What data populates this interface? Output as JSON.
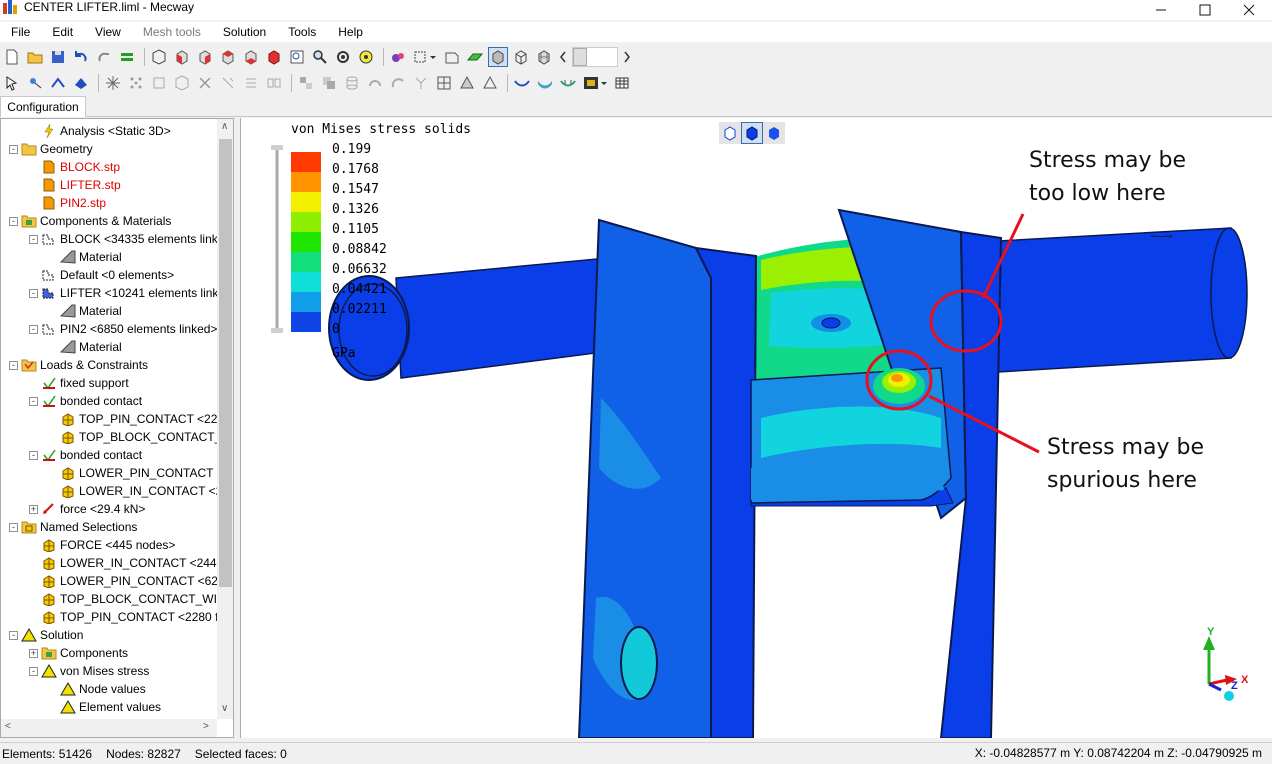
{
  "window": {
    "title": "CENTER LIFTER.liml - Mecway"
  },
  "menu": [
    {
      "label": "File",
      "enabled": true
    },
    {
      "label": "Edit",
      "enabled": true
    },
    {
      "label": "View",
      "enabled": true
    },
    {
      "label": "Mesh tools",
      "enabled": false
    },
    {
      "label": "Solution",
      "enabled": true
    },
    {
      "label": "Tools",
      "enabled": true
    },
    {
      "label": "Help",
      "enabled": true
    }
  ],
  "config_tab": {
    "label": "Configuration"
  },
  "tree": [
    {
      "label": "Analysis <Static 3D>",
      "level": 1,
      "icon": "analysis-icon",
      "color": "black",
      "expander": ""
    },
    {
      "label": "Geometry",
      "level": 0,
      "icon": "folder-icon",
      "color": "black",
      "expander": "-"
    },
    {
      "label": "BLOCK.stp",
      "level": 1,
      "icon": "geometry-file-icon",
      "color": "red",
      "expander": ""
    },
    {
      "label": "LIFTER.stp",
      "level": 1,
      "icon": "geometry-file-icon",
      "color": "red",
      "expander": ""
    },
    {
      "label": "PIN2.stp",
      "level": 1,
      "icon": "geometry-file-icon",
      "color": "red",
      "expander": ""
    },
    {
      "label": "Components & Materials",
      "level": 0,
      "icon": "components-icon",
      "color": "black",
      "expander": "-"
    },
    {
      "label": "BLOCK <34335 elements link",
      "level": 1,
      "icon": "component-icon",
      "color": "black",
      "expander": "-"
    },
    {
      "label": "Material",
      "level": 2,
      "icon": "material-icon",
      "color": "black",
      "expander": ""
    },
    {
      "label": "Default <0 elements>",
      "level": 1,
      "icon": "component-icon",
      "color": "black",
      "expander": ""
    },
    {
      "label": "LIFTER <10241 elements linke",
      "level": 1,
      "icon": "component-blue-icon",
      "color": "black",
      "expander": "-"
    },
    {
      "label": "Material",
      "level": 2,
      "icon": "material-icon",
      "color": "black",
      "expander": ""
    },
    {
      "label": "PIN2 <6850 elements linked>",
      "level": 1,
      "icon": "component-icon",
      "color": "black",
      "expander": "-"
    },
    {
      "label": "Material",
      "level": 2,
      "icon": "material-icon",
      "color": "black",
      "expander": ""
    },
    {
      "label": "Loads & Constraints",
      "level": 0,
      "icon": "loads-folder-icon",
      "color": "black",
      "expander": "-"
    },
    {
      "label": "fixed support",
      "level": 1,
      "icon": "constraint-icon",
      "color": "black",
      "expander": ""
    },
    {
      "label": "bonded contact",
      "level": 1,
      "icon": "constraint-icon",
      "color": "black",
      "expander": "-"
    },
    {
      "label": "TOP_PIN_CONTACT <228",
      "level": 2,
      "icon": "selection-icon",
      "color": "black",
      "expander": ""
    },
    {
      "label": "TOP_BLOCK_CONTACT_W",
      "level": 2,
      "icon": "selection-icon",
      "color": "black",
      "expander": ""
    },
    {
      "label": "bonded contact",
      "level": 1,
      "icon": "constraint-icon",
      "color": "black",
      "expander": "-"
    },
    {
      "label": "LOWER_PIN_CONTACT <",
      "level": 2,
      "icon": "selection-icon",
      "color": "black",
      "expander": ""
    },
    {
      "label": "LOWER_IN_CONTACT <2",
      "level": 2,
      "icon": "selection-icon",
      "color": "black",
      "expander": ""
    },
    {
      "label": "force <29.4 kN>",
      "level": 1,
      "icon": "force-icon",
      "color": "black",
      "expander": "+"
    },
    {
      "label": "Named Selections",
      "level": 0,
      "icon": "named-selections-icon",
      "color": "black",
      "expander": "-"
    },
    {
      "label": "FORCE <445 nodes>",
      "level": 1,
      "icon": "selection-icon",
      "color": "black",
      "expander": ""
    },
    {
      "label": "LOWER_IN_CONTACT <244 f",
      "level": 1,
      "icon": "selection-icon",
      "color": "black",
      "expander": ""
    },
    {
      "label": "LOWER_PIN_CONTACT <623",
      "level": 1,
      "icon": "selection-icon",
      "color": "black",
      "expander": ""
    },
    {
      "label": "TOP_BLOCK_CONTACT_WIT",
      "level": 1,
      "icon": "selection-icon",
      "color": "black",
      "expander": ""
    },
    {
      "label": "TOP_PIN_CONTACT <2280 f",
      "level": 1,
      "icon": "selection-icon",
      "color": "black",
      "expander": ""
    },
    {
      "label": "Solution",
      "level": 0,
      "icon": "solution-icon",
      "color": "black",
      "expander": "-"
    },
    {
      "label": "Components",
      "level": 1,
      "icon": "components-icon",
      "color": "black",
      "expander": "+"
    },
    {
      "label": "von Mises stress",
      "level": 1,
      "icon": "solution-icon",
      "color": "black",
      "expander": "-"
    },
    {
      "label": "Node values",
      "level": 2,
      "icon": "solution-icon",
      "color": "black",
      "expander": ""
    },
    {
      "label": "Element values",
      "level": 2,
      "icon": "solution-icon",
      "color": "black",
      "expander": ""
    }
  ],
  "viewport": {
    "legend": {
      "title": "von Mises stress solids",
      "values": [
        "0.199",
        "0.1768",
        "0.1547",
        "0.1326",
        "0.1105",
        "0.08842",
        "0.06632",
        "0.04421",
        "0.02211",
        "0"
      ],
      "colors": [
        "#ff3a00",
        "#ff9400",
        "#f2ef00",
        "#8ef000",
        "#1ee600",
        "#13e07c",
        "#10dfd9",
        "#119ee8",
        "#0f45e6"
      ],
      "unit": "GPa"
    },
    "annotations": {
      "low": {
        "line1": "Stress may be",
        "line2": "too low here"
      },
      "spurious": {
        "line1": "Stress may be",
        "line2": "spurious here"
      }
    },
    "annotation_color": "#e8101e",
    "axis_labels": {
      "y": "Y",
      "x": "X",
      "z": "Z"
    }
  },
  "status": {
    "elements_label": "Elements: 51426",
    "nodes_label": "Nodes: 82827",
    "selected_label": "Selected faces: 0",
    "coords": "X: -0.04828577 m Y: 0.08742204 m Z: -0.04790925 m"
  },
  "colors": {
    "model_blue": "#0a3ee8",
    "accent_selection": "#3a6ea5"
  }
}
